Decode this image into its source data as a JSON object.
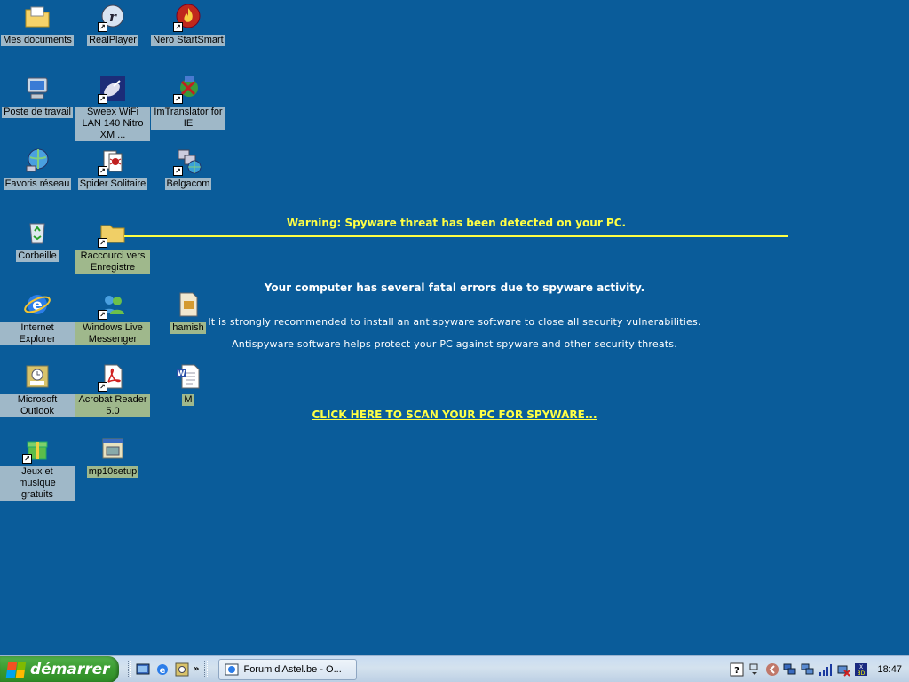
{
  "desktop": {
    "icons": [
      {
        "label": "Mes documents"
      },
      {
        "label": "RealPlayer"
      },
      {
        "label": "Nero StartSmart"
      },
      {
        "label": "Poste de travail"
      },
      {
        "label": "Sweex WiFi LAN 140 Nitro XM ..."
      },
      {
        "label": "ImTranslator for IE"
      },
      {
        "label": "Favoris réseau"
      },
      {
        "label": "Spider Solitaire"
      },
      {
        "label": "Belgacom"
      },
      {
        "label": "Corbeille"
      },
      {
        "label": "Raccourci vers Enregistre"
      },
      {
        "label": "Internet Explorer"
      },
      {
        "label": "Windows Live Messenger"
      },
      {
        "label": "hamish"
      },
      {
        "label": "Microsoft Outlook"
      },
      {
        "label": "Acrobat Reader 5.0"
      },
      {
        "label": "M"
      },
      {
        "label": "Jeux et musique gratuits"
      },
      {
        "label": "mp10setup"
      }
    ]
  },
  "message": {
    "warning": "Warning: Spyware threat has been detected on your PC.",
    "main": "Your computer has several fatal errors due to spyware activity.",
    "recommend": "It is strongly recommended to install an antispyware software to close all security vulnerabilities.",
    "helps": "Antispyware software helps protect your PC against spyware and other security threats.",
    "scan_link": "CLICK HERE TO SCAN YOUR PC FOR SPYWARE..."
  },
  "taskbar": {
    "start_label": "démarrer",
    "task_label": "Forum d'Astel.be - O...",
    "clock": "18:47",
    "quick_chevron": "»"
  },
  "colors": {
    "desktop": "#0a5c9a",
    "warning_yellow": "#ffff44",
    "start_green": "#3a9b30"
  }
}
